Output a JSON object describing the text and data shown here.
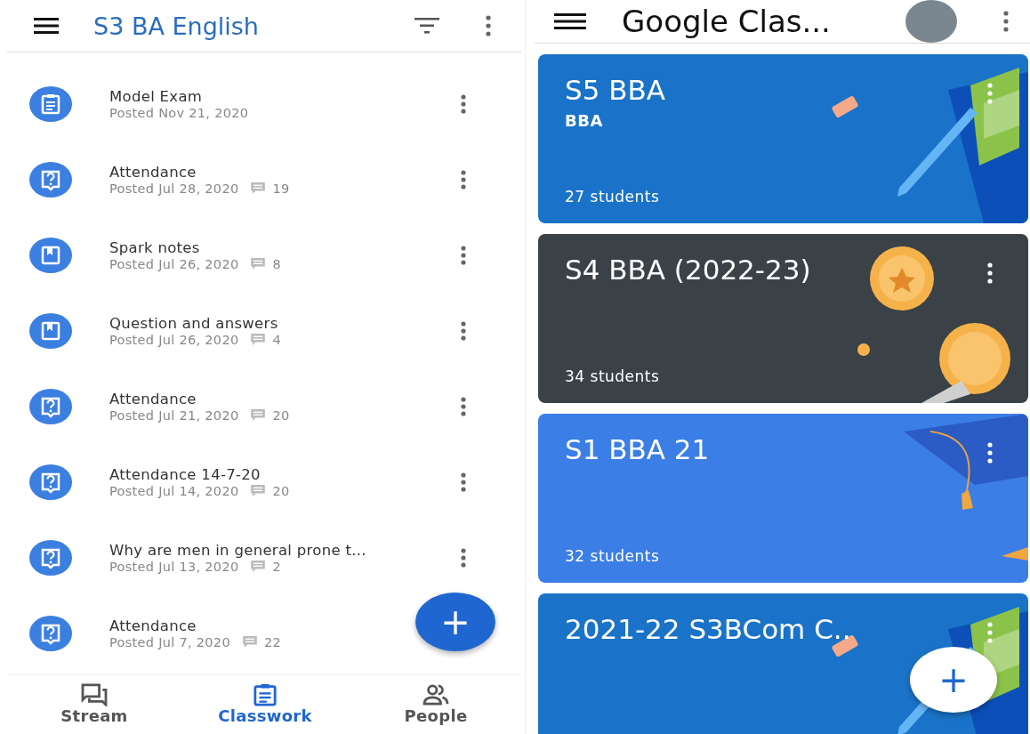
{
  "classwork_screen": {
    "title": "S3 BA English",
    "items": [
      {
        "kind": "assignment",
        "title": "Model Exam",
        "posted": "Posted Nov 21, 2020"
      },
      {
        "kind": "question",
        "title": "Attendance",
        "posted": "Posted Jul 28, 2020",
        "comments": "19"
      },
      {
        "kind": "material",
        "title": "Spark notes",
        "posted": "Posted Jul 26, 2020",
        "comments": "8"
      },
      {
        "kind": "material",
        "title": "Question and answers",
        "posted": "Posted Jul 26, 2020",
        "comments": "4"
      },
      {
        "kind": "question",
        "title": "Attendance",
        "posted": "Posted Jul 21, 2020",
        "comments": "20"
      },
      {
        "kind": "question",
        "title": "Attendance 14-7-20",
        "posted": "Posted Jul 14, 2020",
        "comments": "20"
      },
      {
        "kind": "question",
        "title": "Why are men in general prone t...",
        "posted": "Posted Jul 13, 2020",
        "comments": "2"
      },
      {
        "kind": "question",
        "title": "Attendance",
        "posted": "Posted Jul 7, 2020",
        "comments": "22"
      }
    ],
    "fab": "+",
    "nav": [
      {
        "kind": "stream",
        "label": "Stream",
        "selected": false
      },
      {
        "kind": "classwork",
        "label": "Classwork",
        "selected": true
      },
      {
        "kind": "people",
        "label": "People",
        "selected": false
      }
    ]
  },
  "classes_screen": {
    "title": "Google Clas...",
    "cards": [
      {
        "kind": "pencil",
        "title": "S5 BBA",
        "section": "BBA",
        "students": "27 students",
        "color": "#1a73c8"
      },
      {
        "kind": "medal",
        "title": "S4 BBA (2022-23)",
        "students": "34 students",
        "color": "#3a4247"
      },
      {
        "kind": "cap",
        "title": "S1 BBA 21",
        "students": "32 students",
        "color": "#3b7ee6"
      },
      {
        "kind": "pencil",
        "title": "2021-22 S3BCom C..",
        "color": "#1a73c8"
      }
    ],
    "fab": "+"
  }
}
